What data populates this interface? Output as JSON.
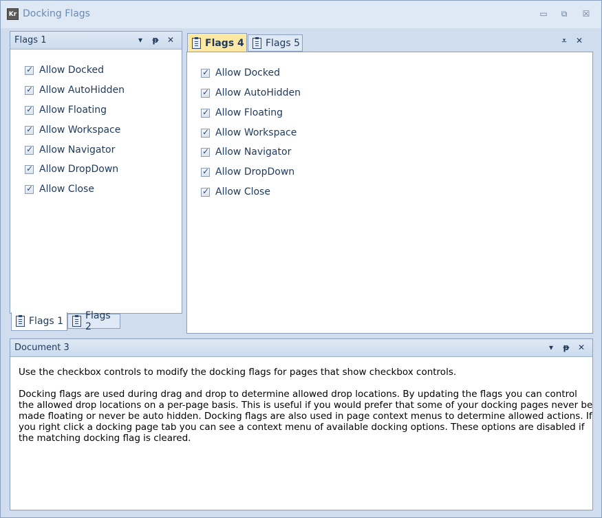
{
  "window": {
    "app_icon_text": "Kr",
    "title": "Docking Flags",
    "min_glyph": "▭",
    "max_glyph": "⧉",
    "close_glyph": "☒"
  },
  "icons": {
    "dropdown": "▾",
    "pin": "ᵽ",
    "close": "✕",
    "overflow": "⩡"
  },
  "left_panel": {
    "header_title": "Flags 1",
    "checkboxes": [
      "Allow Docked",
      "Allow AutoHidden",
      "Allow Floating",
      "Allow Workspace",
      "Allow Navigator",
      "Allow DropDown",
      "Allow Close"
    ],
    "tabs": [
      {
        "label": "Flags 1",
        "active": true
      },
      {
        "label": "Flags 2",
        "active": false
      }
    ]
  },
  "right_panel": {
    "tabs": [
      {
        "label": "Flags 4",
        "active": true
      },
      {
        "label": "Flags 5",
        "active": false
      }
    ],
    "checkboxes": [
      "Allow Docked",
      "Allow AutoHidden",
      "Allow Floating",
      "Allow Workspace",
      "Allow Navigator",
      "Allow DropDown",
      "Allow Close"
    ]
  },
  "bottom_panel": {
    "header_title": "Document 3",
    "paragraph1": "Use the checkbox controls to modify the docking flags for pages that show checkbox controls.",
    "paragraph2": "Docking flags are used during drag and drop to determine allowed drop locations. By updating the flags you can control the allowed drop locations on a per-page basis. This is useful if you would prefer that some of your docking pages never be made floating or never be auto hidden. Docking flags are also used in page context menus to determine allowed actions. If you right click a docking page tab you can see a context menu of available docking options. These options are disabled if the matching docking flag is cleared."
  },
  "colors": {
    "active_tab": "#fde9a3",
    "frame_border": "#8ba0bc",
    "background": "#cfddee"
  }
}
